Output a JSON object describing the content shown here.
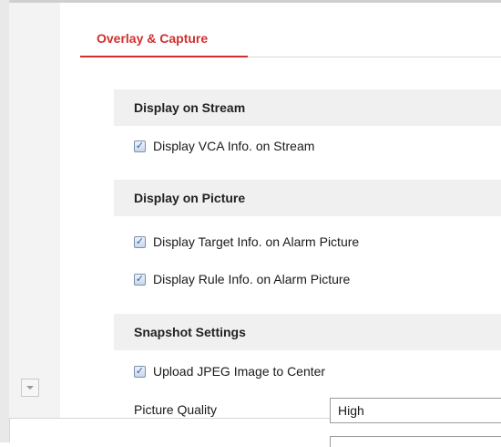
{
  "tab": {
    "label": "Overlay & Capture"
  },
  "sections": {
    "stream": {
      "title": "Display on Stream",
      "vca_label": "Display VCA Info. on Stream"
    },
    "picture": {
      "title": "Display on Picture",
      "target_label": "Display Target Info. on Alarm Picture",
      "rule_label": "Display Rule Info. on Alarm Picture"
    },
    "snapshot": {
      "title": "Snapshot Settings",
      "upload_label": "Upload JPEG Image to Center",
      "quality_label": "Picture Quality",
      "quality_value": "High"
    }
  },
  "checkbox_mark": "✓",
  "icons": {
    "scroll": "chevron-down-icon",
    "check": "check-icon"
  },
  "colors": {
    "accent": "#d12f2f",
    "section_bg": "#f0f0f0"
  }
}
